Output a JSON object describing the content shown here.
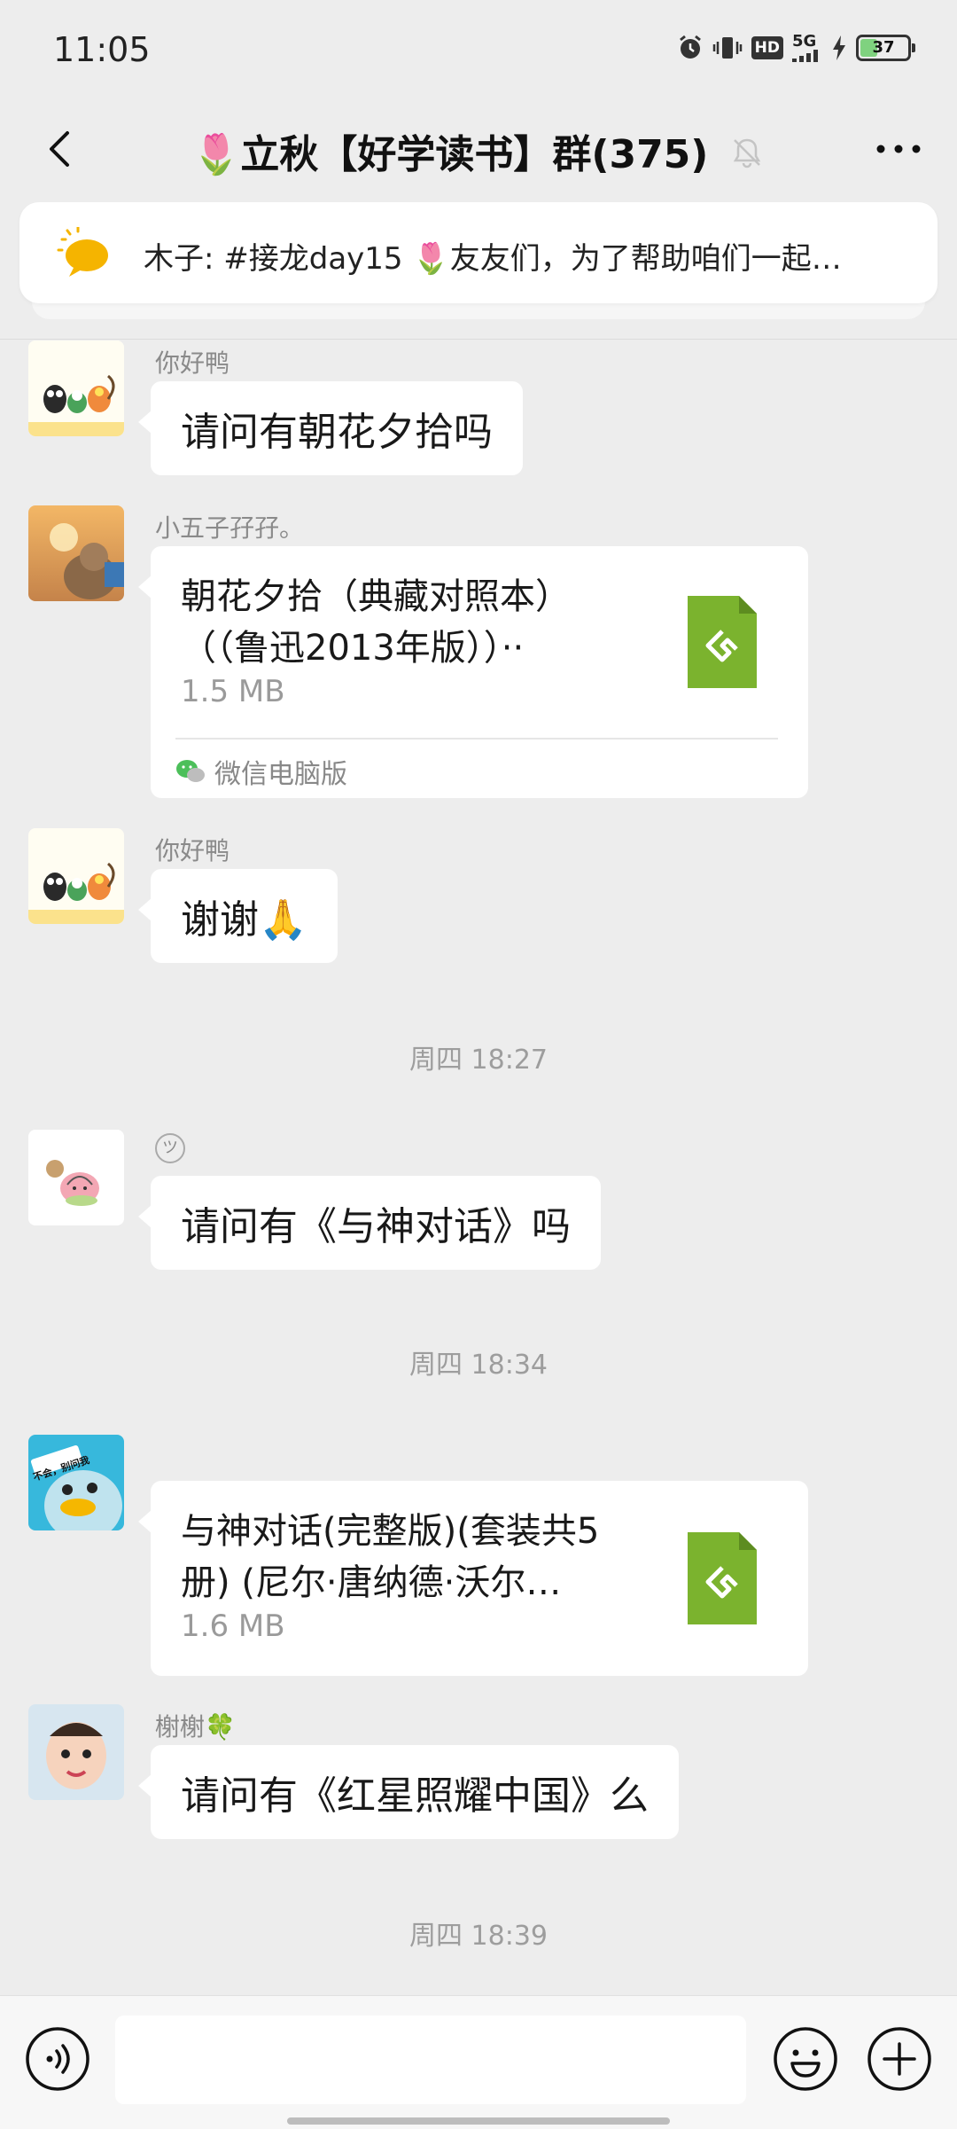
{
  "status_bar": {
    "time": "11:05",
    "hd_label": "HD",
    "network_label": "5G",
    "battery_level": "37",
    "battery_fraction": 0.37
  },
  "header": {
    "title": "🌷立秋【好学读书】群(375)"
  },
  "pinned": {
    "text": "木子: #接龙day15 🌷友友们，为了帮助咱们一起…"
  },
  "messages": [
    {
      "sender": "你好鸭",
      "text": "请问有朝花夕拾吗"
    },
    {
      "sender": "小五子孖孖。",
      "file": {
        "name_line1": "朝花夕拾（典藏对照本）",
        "name_line2": "（（鲁迅2013年版））··",
        "size": "1.5 MB",
        "source": "微信电脑版"
      }
    },
    {
      "sender": "你好鸭",
      "text": "谢谢🙏"
    },
    {
      "timestamp": "周四 18:27"
    },
    {
      "sender": "ツ",
      "text": "请问有《与神对话》吗"
    },
    {
      "timestamp": "周四 18:34"
    },
    {
      "sender": "",
      "avatar_text": "不会，别问我",
      "file": {
        "name_line1": "与神对话(完整版)(套装共5",
        "name_line2": "册) (尼尔·唐纳德·沃尔…",
        "size": "1.6 MB"
      }
    },
    {
      "sender": "榭榭🍀",
      "text": "请问有《红星照耀中国》么"
    },
    {
      "timestamp": "周四 18:39"
    }
  ],
  "colors": {
    "background": "#ededed",
    "bubble": "#ffffff",
    "file_icon": "#7bb32e"
  }
}
